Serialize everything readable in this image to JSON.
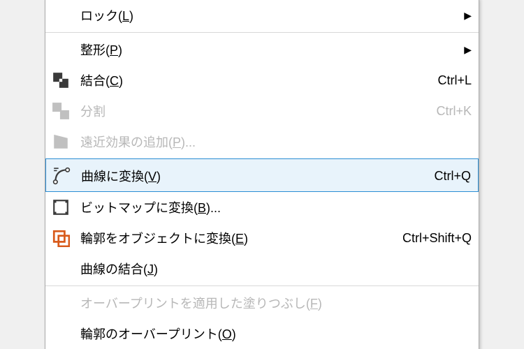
{
  "menu": {
    "items": [
      {
        "label_pre": "ロック",
        "mn": "L",
        "label_post": "",
        "shortcut": "",
        "submenu": true,
        "disabled": false,
        "icon": null,
        "sep": false
      },
      {
        "label_pre": "整形",
        "mn": "P",
        "label_post": "",
        "shortcut": "",
        "submenu": true,
        "disabled": false,
        "icon": null,
        "sep": true
      },
      {
        "label_pre": "結合",
        "mn": "C",
        "label_post": "",
        "shortcut": "Ctrl+L",
        "submenu": false,
        "disabled": false,
        "icon": "combine",
        "sep": false
      },
      {
        "label_pre": "分割",
        "mn": "",
        "label_post": "",
        "shortcut": "Ctrl+K",
        "submenu": false,
        "disabled": true,
        "icon": "break",
        "sep": false
      },
      {
        "label_pre": "遠近効果の追加",
        "mn": "P",
        "label_post": "...",
        "shortcut": "",
        "submenu": false,
        "disabled": true,
        "icon": "perspective",
        "sep": false
      },
      {
        "label_pre": "曲線に変換",
        "mn": "V",
        "label_post": "",
        "shortcut": "Ctrl+Q",
        "submenu": false,
        "disabled": false,
        "icon": "curve",
        "sep": true,
        "selected": true
      },
      {
        "label_pre": "ビットマップに変換",
        "mn": "B",
        "label_post": "...",
        "shortcut": "",
        "submenu": false,
        "disabled": false,
        "icon": "bitmap",
        "sep": false
      },
      {
        "label_pre": "輪郭をオブジェクトに変換",
        "mn": "E",
        "label_post": "",
        "shortcut": "Ctrl+Shift+Q",
        "submenu": false,
        "disabled": false,
        "icon": "outline",
        "sep": false
      },
      {
        "label_pre": "曲線の結合",
        "mn": "J",
        "label_post": "",
        "shortcut": "",
        "submenu": false,
        "disabled": false,
        "icon": null,
        "sep": false
      },
      {
        "label_pre": "オーバープリントを適用した塗りつぶし",
        "mn": "F",
        "label_post": "",
        "shortcut": "",
        "submenu": false,
        "disabled": true,
        "icon": null,
        "sep": true
      },
      {
        "label_pre": "輪郭のオーバープリント",
        "mn": "O",
        "label_post": "",
        "shortcut": "",
        "submenu": false,
        "disabled": false,
        "icon": null,
        "sep": false
      }
    ]
  },
  "icons": {
    "combine": "combine-icon",
    "break": "break-icon",
    "perspective": "perspective-icon",
    "curve": "curve-icon",
    "bitmap": "bitmap-icon",
    "outline": "outline-icon"
  }
}
